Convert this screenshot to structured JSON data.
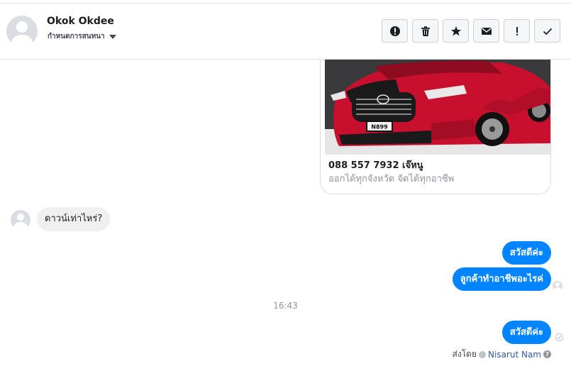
{
  "header": {
    "contact_name": "Okok Okdee",
    "subtitle": "กำหนดการสนทนา",
    "actions": [
      {
        "name": "report-icon",
        "label": "!"
      },
      {
        "name": "trash-icon",
        "label": ""
      },
      {
        "name": "star-icon",
        "label": ""
      },
      {
        "name": "envelope-icon",
        "label": ""
      },
      {
        "name": "exclamation-icon",
        "label": "!"
      },
      {
        "name": "checkmark-icon",
        "label": ""
      }
    ]
  },
  "card": {
    "plate_text": "N899",
    "title": "088 557 7932 เจ๊หนู",
    "subtitle": "ออกได้ทุกจังหวัด จัดได้ทุกอาชีพ"
  },
  "messages": {
    "incoming": "ดาวน์เท่าไหร่?",
    "outgoing_1": "สวัสดีค่ะ",
    "outgoing_2": "ลูกค้าทำอาชีพอะไรค่",
    "time": "16:43",
    "outgoing_3": "สวัสดีค่ะ"
  },
  "footer": {
    "sent_by_label": "ส่งโดย",
    "sender_name": "Nisarut Nam",
    "help": "?"
  },
  "colors": {
    "accent_blue": "#0084ff",
    "car_red": "#c8102e",
    "link": "#365899"
  }
}
